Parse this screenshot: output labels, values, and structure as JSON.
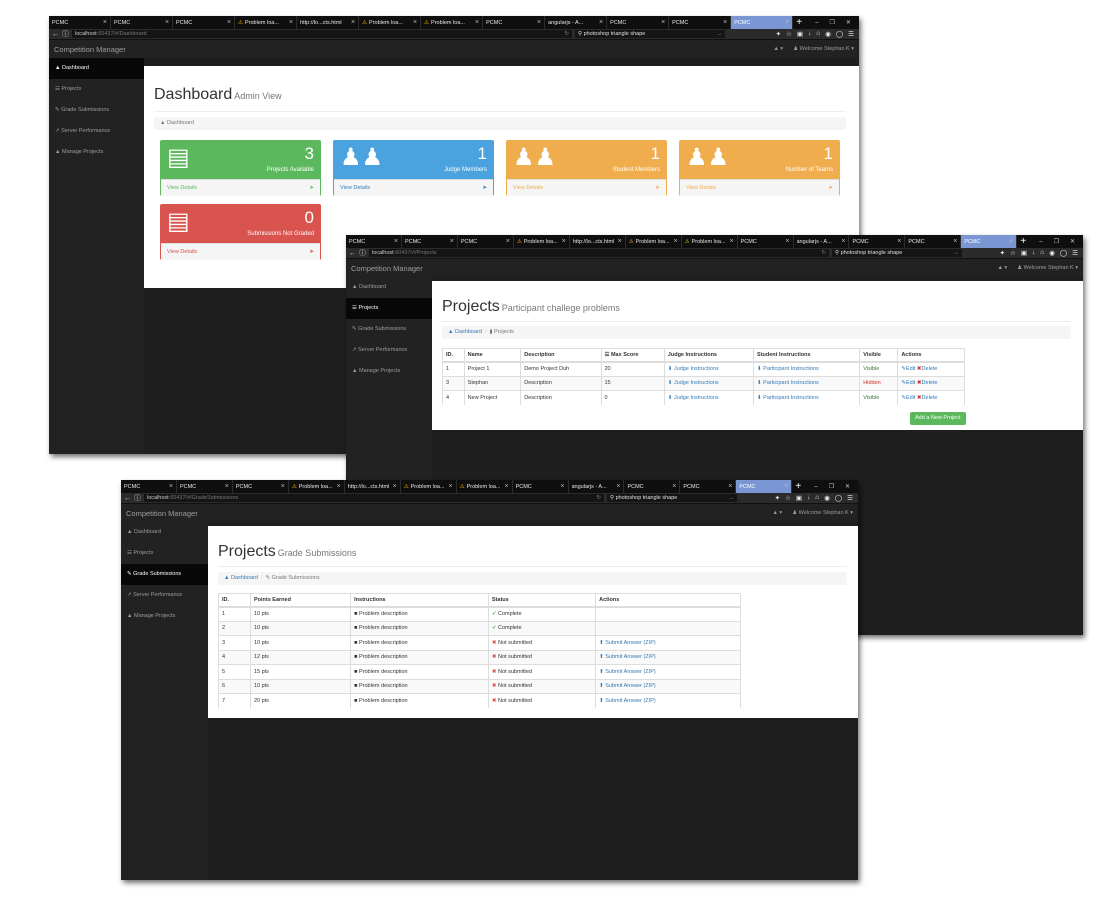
{
  "windows": [
    {
      "tabs": [
        "PCMC",
        "PCMC",
        "PCMC",
        "Problem loa...",
        "http://lo...cts.html",
        "Problem loa...",
        "Problem loa...",
        "PCMC",
        "angularjs - A...",
        "PCMC",
        "PCMC",
        "PCMC"
      ],
      "url_host": "localhost",
      "url_path": ":60437/#/Dashboard",
      "search": "photoshop triangle shape",
      "brand": "Competition Manager",
      "welcome": "Welcome Stephan K",
      "sidebar": [
        "Dashboard",
        "Projects",
        "Grade Submissions",
        "Server Performance",
        "Manage Projects"
      ],
      "title": "Dashboard",
      "subtitle": "Admin View",
      "breadcrumb": [
        "Dashboard"
      ],
      "panels": [
        {
          "num": "3",
          "label": "Projects Available",
          "link": "View Details",
          "color": "#5cb85c"
        },
        {
          "num": "1",
          "label": "Judge Members",
          "link": "View Details",
          "color": "#4aa3df"
        },
        {
          "num": "1",
          "label": "Student Members",
          "link": "View Details",
          "color": "#f0ad4e"
        },
        {
          "num": "1",
          "label": "Number of Teams",
          "link": "View Details",
          "color": "#f0ad4e"
        },
        {
          "num": "0",
          "label": "Submissions Not Graded",
          "link": "View Details",
          "color": "#d9534f"
        }
      ]
    },
    {
      "tabs": [
        "PCMC",
        "PCMC",
        "PCMC",
        "Problem loa...",
        "http://lo...cts.html",
        "Problem loa...",
        "Problem loa...",
        "PCMC",
        "angularjs - A...",
        "PCMC",
        "PCMC",
        "PCMC"
      ],
      "url_host": "localhost",
      "url_path": ":60437/#/Projects",
      "search": "photoshop triangle shape",
      "brand": "Competition Manager",
      "welcome": "Welcome Stephan K",
      "sidebar": [
        "Dashboard",
        "Projects",
        "Grade Submissions",
        "Server Performance",
        "Manage Projects"
      ],
      "title": "Projects",
      "subtitle": "Participant challege problems",
      "breadcrumb": [
        "Dashboard",
        "Projects"
      ],
      "headers": [
        "ID.",
        "Name",
        "Description",
        "Max Score",
        "Judge Instructions",
        "Student Instructions",
        "Visible",
        "Actions"
      ],
      "rows": [
        [
          "1",
          "Project 1",
          "Demo Project Duh",
          "20",
          "Judge Instructions",
          "Participant Instructions",
          "Visible"
        ],
        [
          "3",
          "Stephan",
          "Description",
          "15",
          "Judge Instructions",
          "Participant Instructions",
          "Hidden"
        ],
        [
          "4",
          "New Project",
          "Description",
          "0",
          "Judge Instructions",
          "Participant Instructions",
          "Visible"
        ]
      ],
      "edit": "Edit",
      "delete": "Delete",
      "add_button": "Add a New Project"
    },
    {
      "tabs": [
        "PCMC",
        "PCMC",
        "PCMC",
        "Problem loa...",
        "http://lo...cts.html",
        "Problem loa...",
        "Problem loa...",
        "PCMC",
        "angularjs - A...",
        "PCMC",
        "PCMC",
        "PCMC"
      ],
      "url_host": "localhost",
      "url_path": ":60437/#/GradeSubmissions",
      "search": "photoshop triangle shape",
      "brand": "Competition Manager",
      "welcome": "Welcome Stephan K",
      "sidebar": [
        "Dashboard",
        "Projects",
        "Grade Submissions",
        "Server Performance",
        "Manage Projects"
      ],
      "title": "Projects",
      "subtitle": "Grade Submissions",
      "breadcrumb": [
        "Dashboard",
        "Grade Submissions"
      ],
      "headers": [
        "ID.",
        "Points Earned",
        "Instructions",
        "Status",
        "Actions"
      ],
      "rows": [
        [
          "1",
          "10 pts",
          "Problem description",
          "Complete",
          ""
        ],
        [
          "2",
          "10 pts",
          "Problem description",
          "Complete",
          ""
        ],
        [
          "3",
          "10 pts",
          "Problem description",
          "Not submitted",
          "Submit Answer (ZIP)"
        ],
        [
          "4",
          "12 pts",
          "Problem description",
          "Not submitted",
          "Submit Answer (ZIP)"
        ],
        [
          "5",
          "15 pts",
          "Problem description",
          "Not submitted",
          "Submit Answer (ZIP)"
        ],
        [
          "6",
          "10 pts",
          "Problem description",
          "Not submitted",
          "Submit Answer (ZIP)"
        ],
        [
          "7",
          "20 pts",
          "Problem description",
          "Not submitted",
          "Submit Answer (ZIP)"
        ]
      ]
    }
  ]
}
